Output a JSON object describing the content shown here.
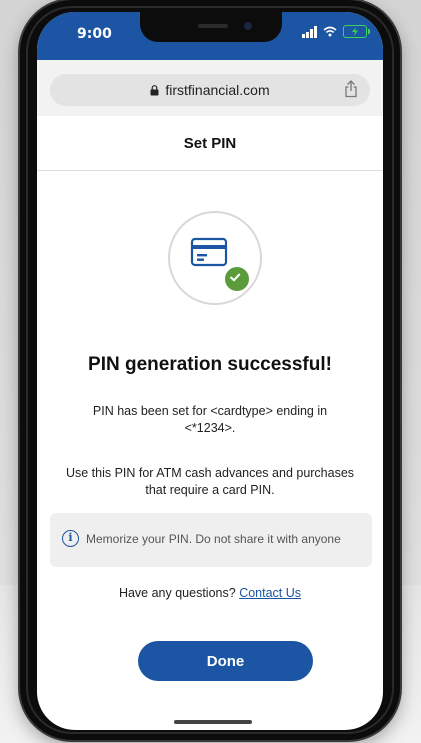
{
  "status": {
    "time": "9:00"
  },
  "browser": {
    "url": "firstfinancial.com"
  },
  "header": {
    "title": "Set PIN"
  },
  "main": {
    "success_title": "PIN generation successful!",
    "message_1": "PIN has been set for <cardtype> ending in <*1234>.",
    "message_2": "Use this PIN for ATM cash advances and purchases that require a card PIN.",
    "info_text": "Memorize your PIN. Do not share it with anyone",
    "questions_text": "Have any questions?",
    "contact_link": "Contact Us",
    "done_label": "Done"
  },
  "colors": {
    "brand_blue": "#1b55a3",
    "success_green": "#5a9c3c",
    "battery_green": "#3bd15d"
  },
  "icons": [
    "lock-icon",
    "share-icon",
    "card-icon",
    "checkmark-icon",
    "info-icon",
    "signal-icon",
    "wifi-icon",
    "battery-icon"
  ]
}
